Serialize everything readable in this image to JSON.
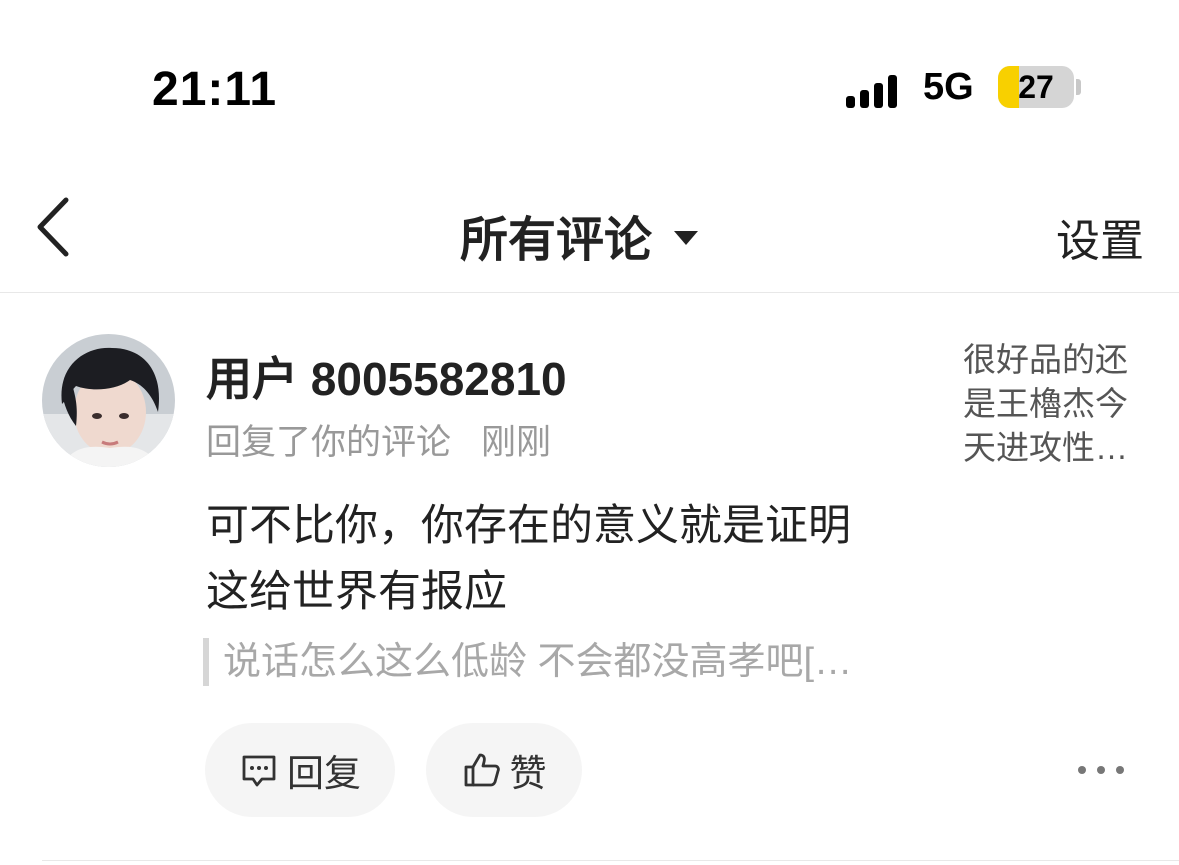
{
  "status_bar": {
    "time": "21:11",
    "network": "5G",
    "battery_level": "27",
    "battery_fraction": 0.27,
    "battery_color": "#f8d000"
  },
  "nav": {
    "back_icon": "chevron-left-icon",
    "title": "所有评论",
    "title_dropdown_icon": "caret-down-icon",
    "settings_label": "设置"
  },
  "comment": {
    "avatar_icon": "user-avatar",
    "username": "用户 8005582810",
    "action": "回复了你的评论",
    "time": "刚刚",
    "reply_lines": [
      "可不比你，你存在的意义就是证明",
      "这给世界有报应"
    ],
    "quoted": "说话怎么这么低龄 不会都没高孝吧[…",
    "original_snippet_lines": [
      "很好品的还",
      "是王櫓杰今",
      "天进攻性…"
    ],
    "reply_button_label": "回复",
    "like_button_label": "赞",
    "reply_icon": "comment-icon",
    "like_icon": "thumbs-up-icon",
    "more_icon": "more-dots-icon"
  }
}
